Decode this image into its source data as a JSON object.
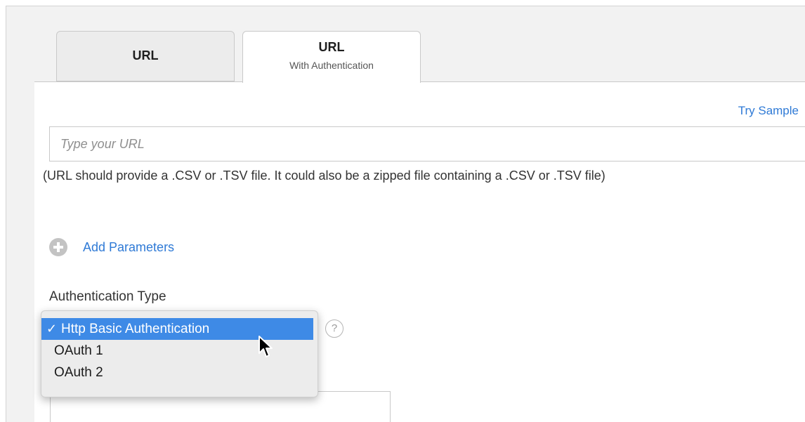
{
  "tabs": [
    {
      "title": "URL",
      "subtitle": ""
    },
    {
      "title": "URL",
      "subtitle": "With Authentication"
    }
  ],
  "try_sample_label": "Try Sample",
  "url_input": {
    "placeholder": "Type your URL",
    "value": ""
  },
  "url_hint": "(URL should provide a .CSV or .TSV file. It could also be a zipped file containing a .CSV or .TSV file)",
  "add_parameters_label": "Add Parameters",
  "authentication": {
    "label": "Authentication Type",
    "help_glyph": "?",
    "check_glyph": "✓",
    "options": [
      "Http Basic Authentication",
      "OAuth 1",
      "OAuth 2"
    ],
    "selected": "Http Basic Authentication"
  },
  "colors": {
    "link": "#2f7ad6",
    "selection": "#3e8ae6",
    "page_background": "#f2f2f2"
  },
  "icons": {
    "add": "plus-circle-icon",
    "help": "question-circle-icon",
    "check": "checkmark-icon",
    "cursor": "mouse-pointer-icon"
  }
}
